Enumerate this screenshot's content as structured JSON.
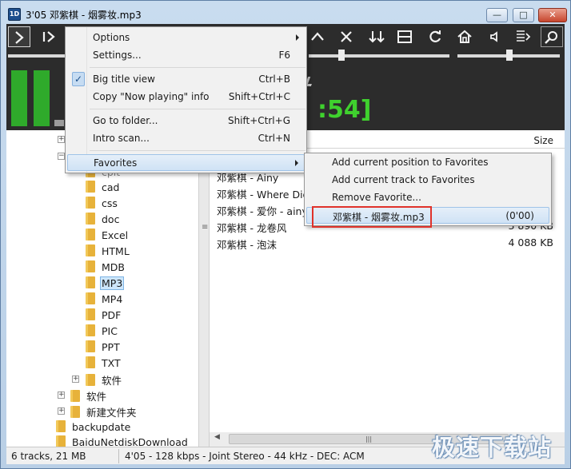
{
  "window": {
    "title": "3'05 邓紫棋 - 烟雾妆.mp3",
    "minimize_glyph": "—",
    "maximize_glyph": "□",
    "close_glyph": "✕"
  },
  "player": {
    "big_time": ":54]",
    "toolbar_icons": [
      "play-icon",
      "play-pause-icon",
      "up-icon",
      "close-x-icon",
      "sort-down-icon",
      "window-layout-icon",
      "refresh-icon",
      "home-icon",
      "volume-icon",
      "playlist-icon",
      "search-icon"
    ]
  },
  "main_menu": {
    "options": "Options",
    "settings": "Settings...",
    "settings_shortcut": "F6",
    "big_title_view": "Big title view",
    "big_title_shortcut": "Ctrl+B",
    "copy_now_playing": "Copy \"Now playing\" info",
    "copy_shortcut": "Shift+Ctrl+C",
    "go_to_folder": "Go to folder...",
    "go_to_folder_shortcut": "Shift+Ctrl+G",
    "intro_scan": "Intro scan...",
    "intro_scan_shortcut": "Ctrl+N",
    "favorites": "Favorites",
    "check_glyph": "✓"
  },
  "favorites_menu": {
    "add_position": "Add current position to Favorites",
    "add_track": "Add current track to Favorites",
    "remove": "Remove Favorite...",
    "entry_name": "邓紫棋 - 烟雾妆.mp3",
    "entry_time": "(0'00)"
  },
  "tree": {
    "folders": [
      "cad",
      "css",
      "doc",
      "Excel",
      "HTML",
      "MDB",
      "MP3",
      "MP4",
      "PDF",
      "PIC",
      "PPT",
      "TXT",
      "软件"
    ],
    "selected": "MP3",
    "partial_top": "cpit",
    "siblings": [
      "软件",
      "新建文件夹"
    ],
    "roots": [
      "backupdate",
      "BaiduNetdiskDownload"
    ]
  },
  "list": {
    "size_header": "Size",
    "tracks": [
      {
        "name": "邓紫棋 - Ainy",
        "size": ""
      },
      {
        "name": "邓紫棋 - Where Did",
        "size": ""
      },
      {
        "name": "邓紫棋 - 爱你 - ainy",
        "size": ""
      },
      {
        "name": "邓紫棋 - 龙卷风",
        "size": "3 890 KB"
      },
      {
        "name": "邓紫棋 - 泡沫",
        "size": "4 088 KB"
      }
    ]
  },
  "statusbar": {
    "summary": "6 tracks, 21 MB",
    "format": "4'05 - 128 kbps - Joint Stereo - 44 kHz - DEC: ACM"
  },
  "watermark": "极速下载站",
  "colors": {
    "time_green": "#3fd12e",
    "vu_green": "#2faa2b",
    "highlight_red": "#e0322a",
    "menu_highlight": "#cfe2f5"
  }
}
